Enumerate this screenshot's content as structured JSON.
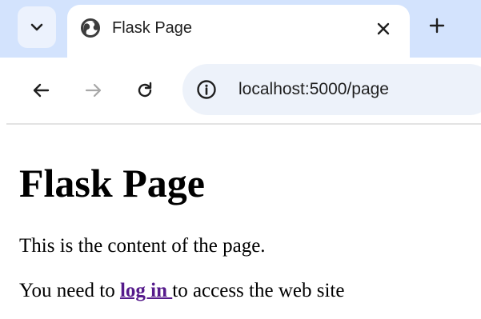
{
  "browser": {
    "tab": {
      "title": "Flask Page"
    },
    "address_bar": {
      "url": "localhost:5000/page"
    },
    "icons": {
      "tab_search": "chevron-down-icon",
      "favicon": "globe-icon",
      "close": "close-icon",
      "new_tab": "plus-icon",
      "back": "arrow-left-icon",
      "forward": "arrow-right-icon",
      "reload": "reload-icon",
      "site_info": "info-icon"
    },
    "colors": {
      "tab_strip": "#d3e3fd",
      "omnibox": "#edf2fa",
      "visited_link": "#551a8b"
    }
  },
  "page": {
    "heading": "Flask Page",
    "paragraph1": "This is the content of the page.",
    "paragraph2_before": "You need to ",
    "login_link": "log in ",
    "paragraph2_after": "to access the web site"
  }
}
